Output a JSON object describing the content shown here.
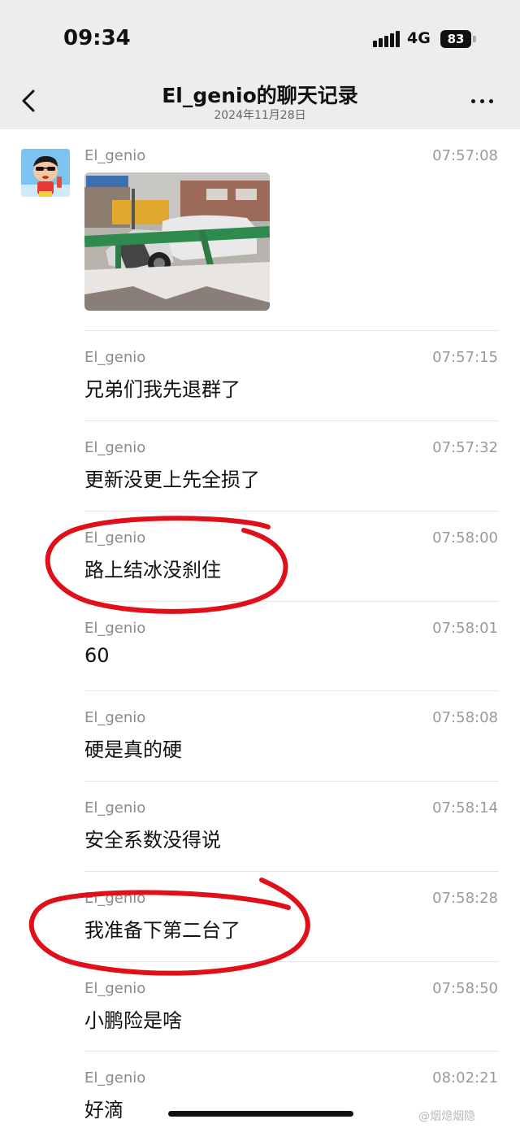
{
  "status": {
    "time": "09:34",
    "network": "4G",
    "battery": "83"
  },
  "header": {
    "title": "El_genio的聊天记录",
    "date": "2024年11月28日"
  },
  "messages": [
    {
      "sender": "El_genio",
      "time": "07:57:08",
      "text": "",
      "type": "image"
    },
    {
      "sender": "El_genio",
      "time": "07:57:15",
      "text": "兄弟们我先退群了"
    },
    {
      "sender": "El_genio",
      "time": "07:57:32",
      "text": "更新没更上先全损了"
    },
    {
      "sender": "El_genio",
      "time": "07:58:00",
      "text": "路上结冰没刹住"
    },
    {
      "sender": "El_genio",
      "time": "07:58:01",
      "text": "60"
    },
    {
      "sender": "El_genio",
      "time": "07:58:08",
      "text": "硬是真的硬"
    },
    {
      "sender": "El_genio",
      "time": "07:58:14",
      "text": "安全系数没得说"
    },
    {
      "sender": "El_genio",
      "time": "07:58:28",
      "text": "我准备下第二台了"
    },
    {
      "sender": "El_genio",
      "time": "07:58:50",
      "text": "小鹏险是啥"
    },
    {
      "sender": "El_genio",
      "time": "08:02:21",
      "text": "好滴"
    }
  ],
  "watermark": "@烟熄烟隐",
  "icons": {
    "back": "chevron-left-icon",
    "more": "more-dots-icon",
    "signal": "signal-bars-icon",
    "battery": "battery-icon"
  },
  "colors": {
    "annotation": "#e0101a",
    "header_bg": "#ededed",
    "guardrail": "#2f8a4e"
  }
}
